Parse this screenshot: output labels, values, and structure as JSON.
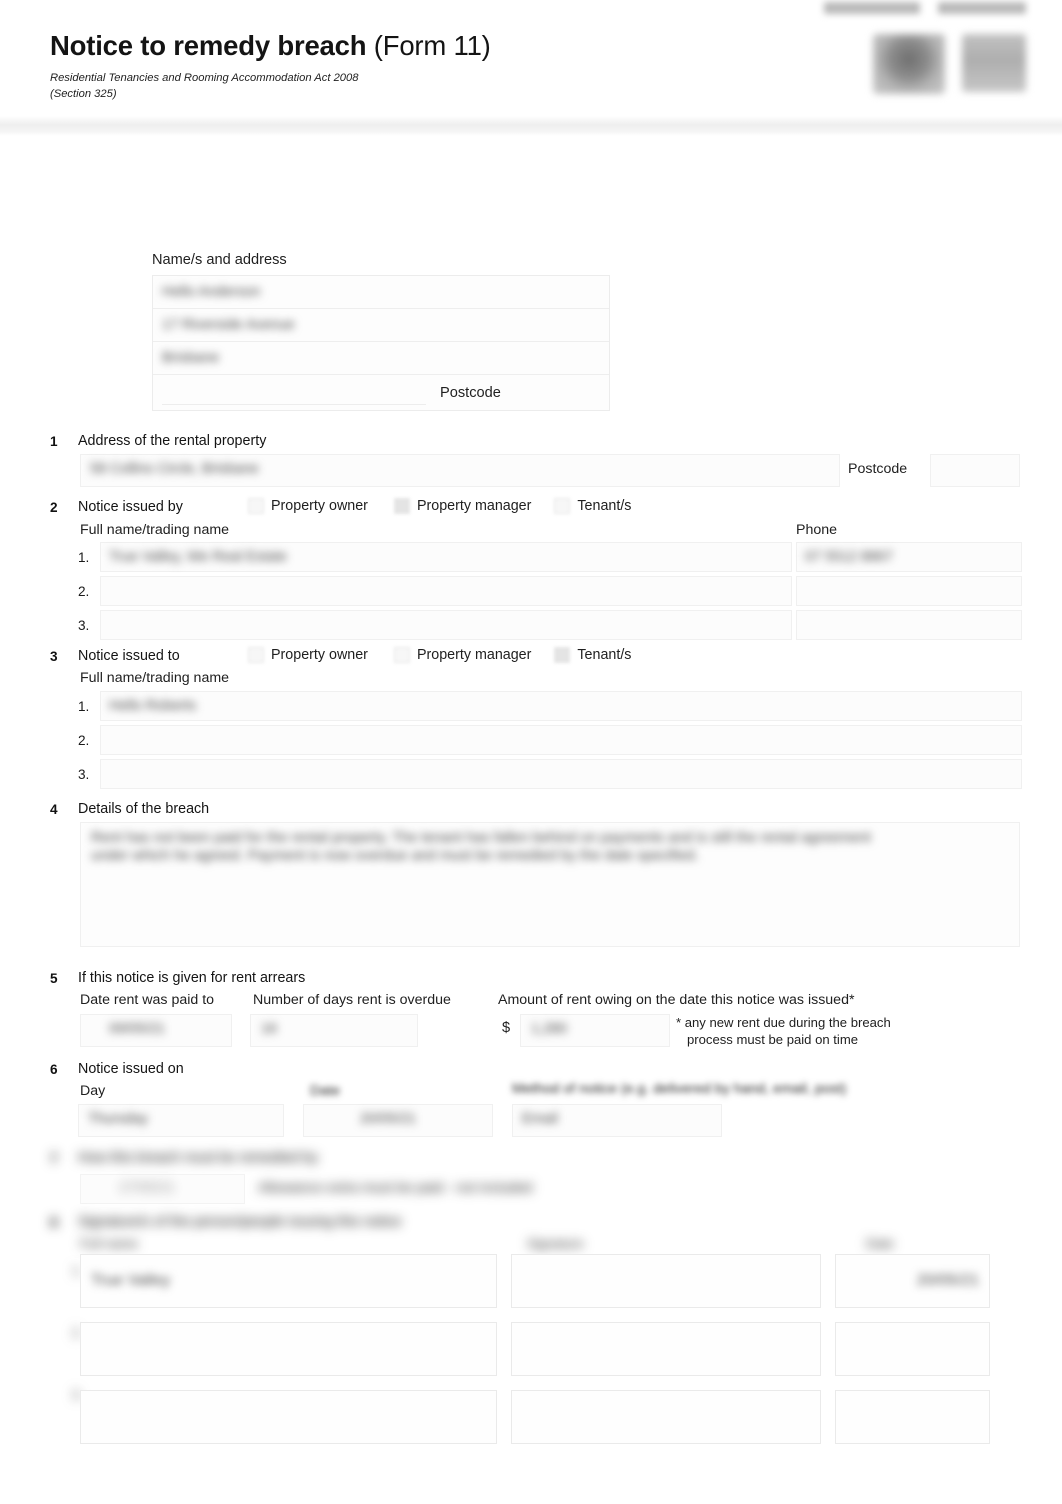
{
  "header": {
    "title_strong": "Notice to remedy breach",
    "title_rest": " (Form 11)",
    "subtitle_line1": "Residential Tenancies and Rooming Accommodation Act 2008",
    "subtitle_line2": "(Section 325)",
    "logo_tab_1": "",
    "logo_tab_2": ""
  },
  "name_address": {
    "label": "Name/s and address",
    "line1": "Hello Anderson",
    "line2": "17 Riverside Avenue",
    "line3": "Brisbane",
    "postcode_label": "Postcode",
    "postcode_value": ""
  },
  "section1": {
    "number": "1",
    "title": "Address of the rental property",
    "address_value": "58 Collins Circle, Brisbane",
    "postcode_label": "Postcode",
    "postcode_value": ""
  },
  "section2": {
    "number": "2",
    "title": "Notice issued by",
    "options": [
      {
        "label": "Property owner",
        "checked": false
      },
      {
        "label": "Property manager",
        "checked": true
      },
      {
        "label": "Tenant/s",
        "checked": false
      }
    ],
    "name_label": "Full name/trading name",
    "phone_label": "Phone",
    "rows": [
      {
        "index": "1.",
        "name": "True Valley, We Real Estate",
        "phone": "07 5512 8867"
      },
      {
        "index": "2.",
        "name": "",
        "phone": ""
      },
      {
        "index": "3.",
        "name": "",
        "phone": ""
      }
    ]
  },
  "section3": {
    "number": "3",
    "title": "Notice issued to",
    "options": [
      {
        "label": "Property owner",
        "checked": false
      },
      {
        "label": "Property manager",
        "checked": false
      },
      {
        "label": "Tenant/s",
        "checked": true
      }
    ],
    "name_label": "Full name/trading name",
    "rows": [
      {
        "index": "1.",
        "name": "Hello Roberts"
      },
      {
        "index": "2.",
        "name": ""
      },
      {
        "index": "3.",
        "name": ""
      }
    ]
  },
  "section4": {
    "number": "4",
    "title": "Details of the breach",
    "text_line1": "Rent has not been paid for the rental property. The tenant has fallen behind on payments and is still the rental agreement",
    "text_line2": "under which he agreed. Payment is now overdue and must be remedied by the date specified."
  },
  "section5": {
    "number": "5",
    "title": "If this notice is given for rent arrears",
    "date_paid_label": "Date rent was paid to",
    "date_paid_value": "09/05/21",
    "days_overdue_label": "Number of days rent is overdue",
    "days_overdue_value": "16",
    "amount_label": "Amount of rent owing on the date this notice was issued*",
    "currency_symbol": "$",
    "amount_value": "1,280",
    "footnote_line1": "* any new rent due during the breach",
    "footnote_line2": "process must be paid on time"
  },
  "section6": {
    "number": "6",
    "title": "Notice issued on",
    "day_label": "Day",
    "day_value": "Thursday",
    "date_label": "Date",
    "date_value": "20/05/21",
    "method_label": "Method of notice (e.g. delivered by hand, email, post)",
    "method_value": "Email"
  },
  "section7": {
    "number": "7",
    "title": "How this breach must be remedied by",
    "date_value": "27/05/21",
    "note": "Allowance extra must be paid - not included"
  },
  "section8": {
    "number": "8",
    "title": "Signature/s of the person/people issuing this notice",
    "col1_header": "Full name",
    "col2_header": "Signature",
    "col3_header": "Date",
    "rows": [
      {
        "index": "1.",
        "name": "True Valley",
        "signature": "",
        "date": "20/05/21"
      },
      {
        "index": "2.",
        "name": "",
        "signature": "",
        "date": ""
      },
      {
        "index": "3.",
        "name": "",
        "signature": "",
        "date": ""
      }
    ]
  },
  "colors": {
    "page_bg": "#ffffff",
    "text": "#1a1a1a",
    "field_bg": "#fcfcfc",
    "field_border": "#f0f0f0",
    "band": "#eeeeee"
  }
}
